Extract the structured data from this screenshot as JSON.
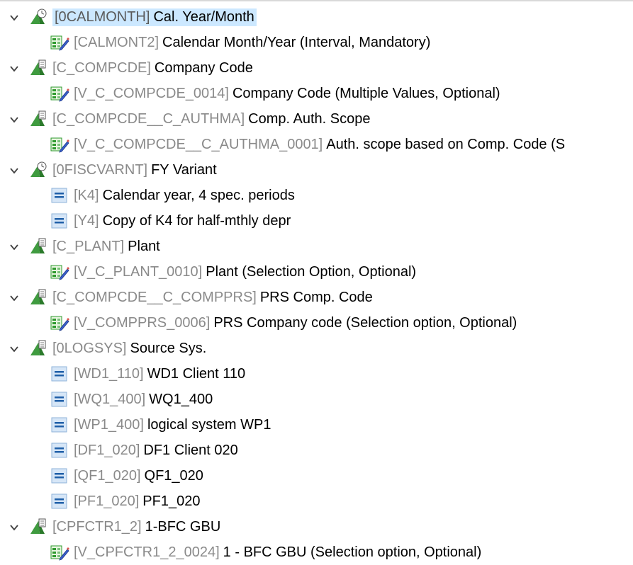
{
  "rows": [
    {
      "level": 0,
      "icon": "hierarchy-time-icon",
      "tech": "[0CALMONTH]",
      "desc": "Cal. Year/Month",
      "selected": true
    },
    {
      "level": 1,
      "icon": "variable-icon",
      "tech": "[CALMONT2]",
      "desc": "Calendar Month/Year (Interval, Mandatory)"
    },
    {
      "level": 0,
      "icon": "hierarchy-icon",
      "tech": "[C_COMPCDE]",
      "desc": "Company Code"
    },
    {
      "level": 1,
      "icon": "variable-icon",
      "tech": "[V_C_COMPCDE_0014]",
      "desc": "Company Code (Multiple Values, Optional)"
    },
    {
      "level": 0,
      "icon": "hierarchy-icon",
      "tech": "[C_COMPCDE__C_AUTHMA]",
      "desc": "Comp. Auth. Scope"
    },
    {
      "level": 1,
      "icon": "variable-icon",
      "tech": "[V_C_COMPCDE__C_AUTHMA_0001]",
      "desc": "Auth. scope based on Comp. Code (S"
    },
    {
      "level": 0,
      "icon": "hierarchy-time-icon",
      "tech": "[0FISCVARNT]",
      "desc": "FY Variant"
    },
    {
      "level": 1,
      "icon": "equals-value-icon",
      "tech": "[K4]",
      "desc": "Calendar year, 4 spec. periods"
    },
    {
      "level": 1,
      "icon": "equals-value-icon",
      "tech": "[Y4]",
      "desc": "Copy of K4 for half-mthly depr"
    },
    {
      "level": 0,
      "icon": "hierarchy-icon",
      "tech": "[C_PLANT]",
      "desc": "Plant"
    },
    {
      "level": 1,
      "icon": "variable-icon",
      "tech": "[V_C_PLANT_0010]",
      "desc": "Plant (Selection Option, Optional)"
    },
    {
      "level": 0,
      "icon": "hierarchy-icon",
      "tech": "[C_COMPCDE__C_COMPPRS]",
      "desc": "PRS Comp. Code"
    },
    {
      "level": 1,
      "icon": "variable-icon",
      "tech": "[V_COMPPRS_0006]",
      "desc": "PRS Company code (Selection option, Optional)"
    },
    {
      "level": 0,
      "icon": "hierarchy-icon",
      "tech": "[0LOGSYS]",
      "desc": "Source Sys."
    },
    {
      "level": 1,
      "icon": "equals-value-icon",
      "tech": "[WD1_110]",
      "desc": "WD1 Client 110"
    },
    {
      "level": 1,
      "icon": "equals-value-icon",
      "tech": "[WQ1_400]",
      "desc": "WQ1_400"
    },
    {
      "level": 1,
      "icon": "equals-value-icon",
      "tech": "[WP1_400]",
      "desc": "logical system WP1"
    },
    {
      "level": 1,
      "icon": "equals-value-icon",
      "tech": "[DF1_020]",
      "desc": "DF1 Client 020"
    },
    {
      "level": 1,
      "icon": "equals-value-icon",
      "tech": "[QF1_020]",
      "desc": "QF1_020"
    },
    {
      "level": 1,
      "icon": "equals-value-icon",
      "tech": "[PF1_020]",
      "desc": "PF1_020"
    },
    {
      "level": 0,
      "icon": "hierarchy-icon",
      "tech": "[CPFCTR1_2]",
      "desc": "1-BFC GBU"
    },
    {
      "level": 1,
      "icon": "variable-icon",
      "tech": "[V_CPFCTR1_2_0024]",
      "desc": "1 - BFC GBU (Selection option, Optional)"
    }
  ],
  "colors": {
    "selection": "#cce8ff",
    "technical_name": "#8a8a8a",
    "hierarchy_green": "#3f9b3f",
    "variable_green": "#2e9a2e",
    "value_blue": "#1f5fa8"
  }
}
